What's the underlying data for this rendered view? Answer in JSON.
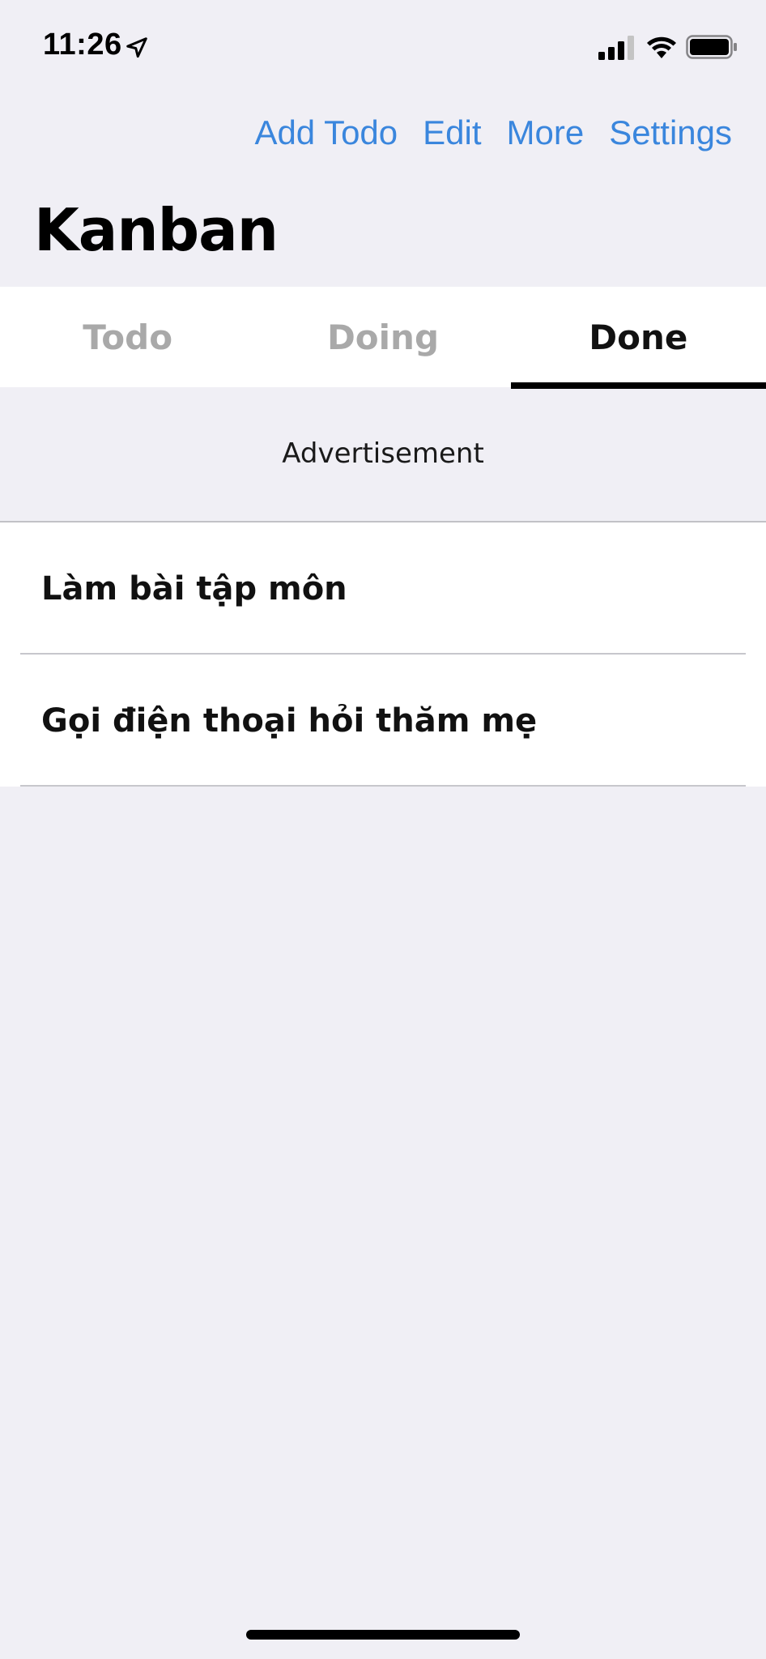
{
  "status_bar": {
    "time": "11:26",
    "icons": [
      "location-arrow-icon",
      "cellular-signal-icon",
      "wifi-icon",
      "battery-icon"
    ]
  },
  "nav": {
    "actions": [
      {
        "label": "Add Todo"
      },
      {
        "label": "Edit"
      },
      {
        "label": "More"
      },
      {
        "label": "Settings"
      }
    ],
    "accent_color": "#3a86dd"
  },
  "page": {
    "title": "Kanban"
  },
  "tabs": [
    {
      "label": "Todo",
      "active": false
    },
    {
      "label": "Doing",
      "active": false
    },
    {
      "label": "Done",
      "active": true
    }
  ],
  "ad": {
    "label": "Advertisement"
  },
  "todos": [
    {
      "title": "Làm bài tập môn"
    },
    {
      "title": "Gọi điện thoại hỏi thăm mẹ"
    }
  ]
}
